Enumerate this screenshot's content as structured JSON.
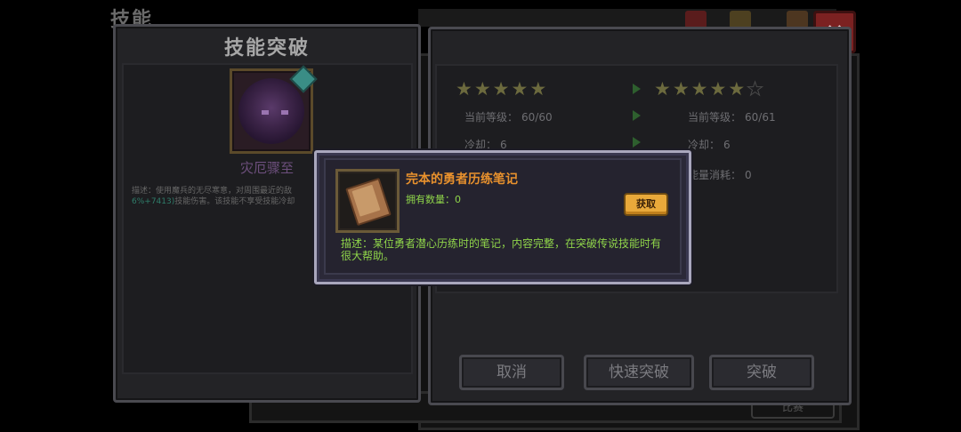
{
  "background": {
    "title": "技能",
    "lower_button_label": "比赛"
  },
  "close_button": {
    "label": "✕"
  },
  "left_panel": {
    "title": "技能突破",
    "skill_name": "灾厄骤至",
    "description_prefix": "描述：使用魔兵的无尽寒意，对周围最近的敌",
    "description_highlight": "6%+7413)",
    "description_suffix": "技能伤害。该技能不享受技能冷却"
  },
  "right_panel": {
    "current": {
      "stars_filled": 5,
      "stars_total": 5,
      "level_label": "当前等级：",
      "level_value": "60/60",
      "cooldown_label": "冷却：",
      "cooldown_value": "6"
    },
    "next": {
      "stars_filled": 5,
      "stars_total": 6,
      "level_label": "当前等级：",
      "level_value": "60/61",
      "cooldown_label": "冷却：",
      "cooldown_value": "6",
      "energy_label": "能量消耗：",
      "energy_value": "0"
    },
    "buttons": {
      "cancel": "取消",
      "quick_break": "快速突破",
      "break": "突破"
    }
  },
  "popup": {
    "item_name": "完本的勇者历练笔记",
    "count_label": "拥有数量：",
    "count_value": "0",
    "get_button": "获取",
    "description": "描述：某位勇者潜心历练时的笔记，内容完整，在突破传说技能时有很大帮助。"
  },
  "colors": {
    "item_name": "#e8912d",
    "item_desc": "#8fd44a",
    "get_button": "#e9a93a",
    "close_button": "#7b2121"
  }
}
